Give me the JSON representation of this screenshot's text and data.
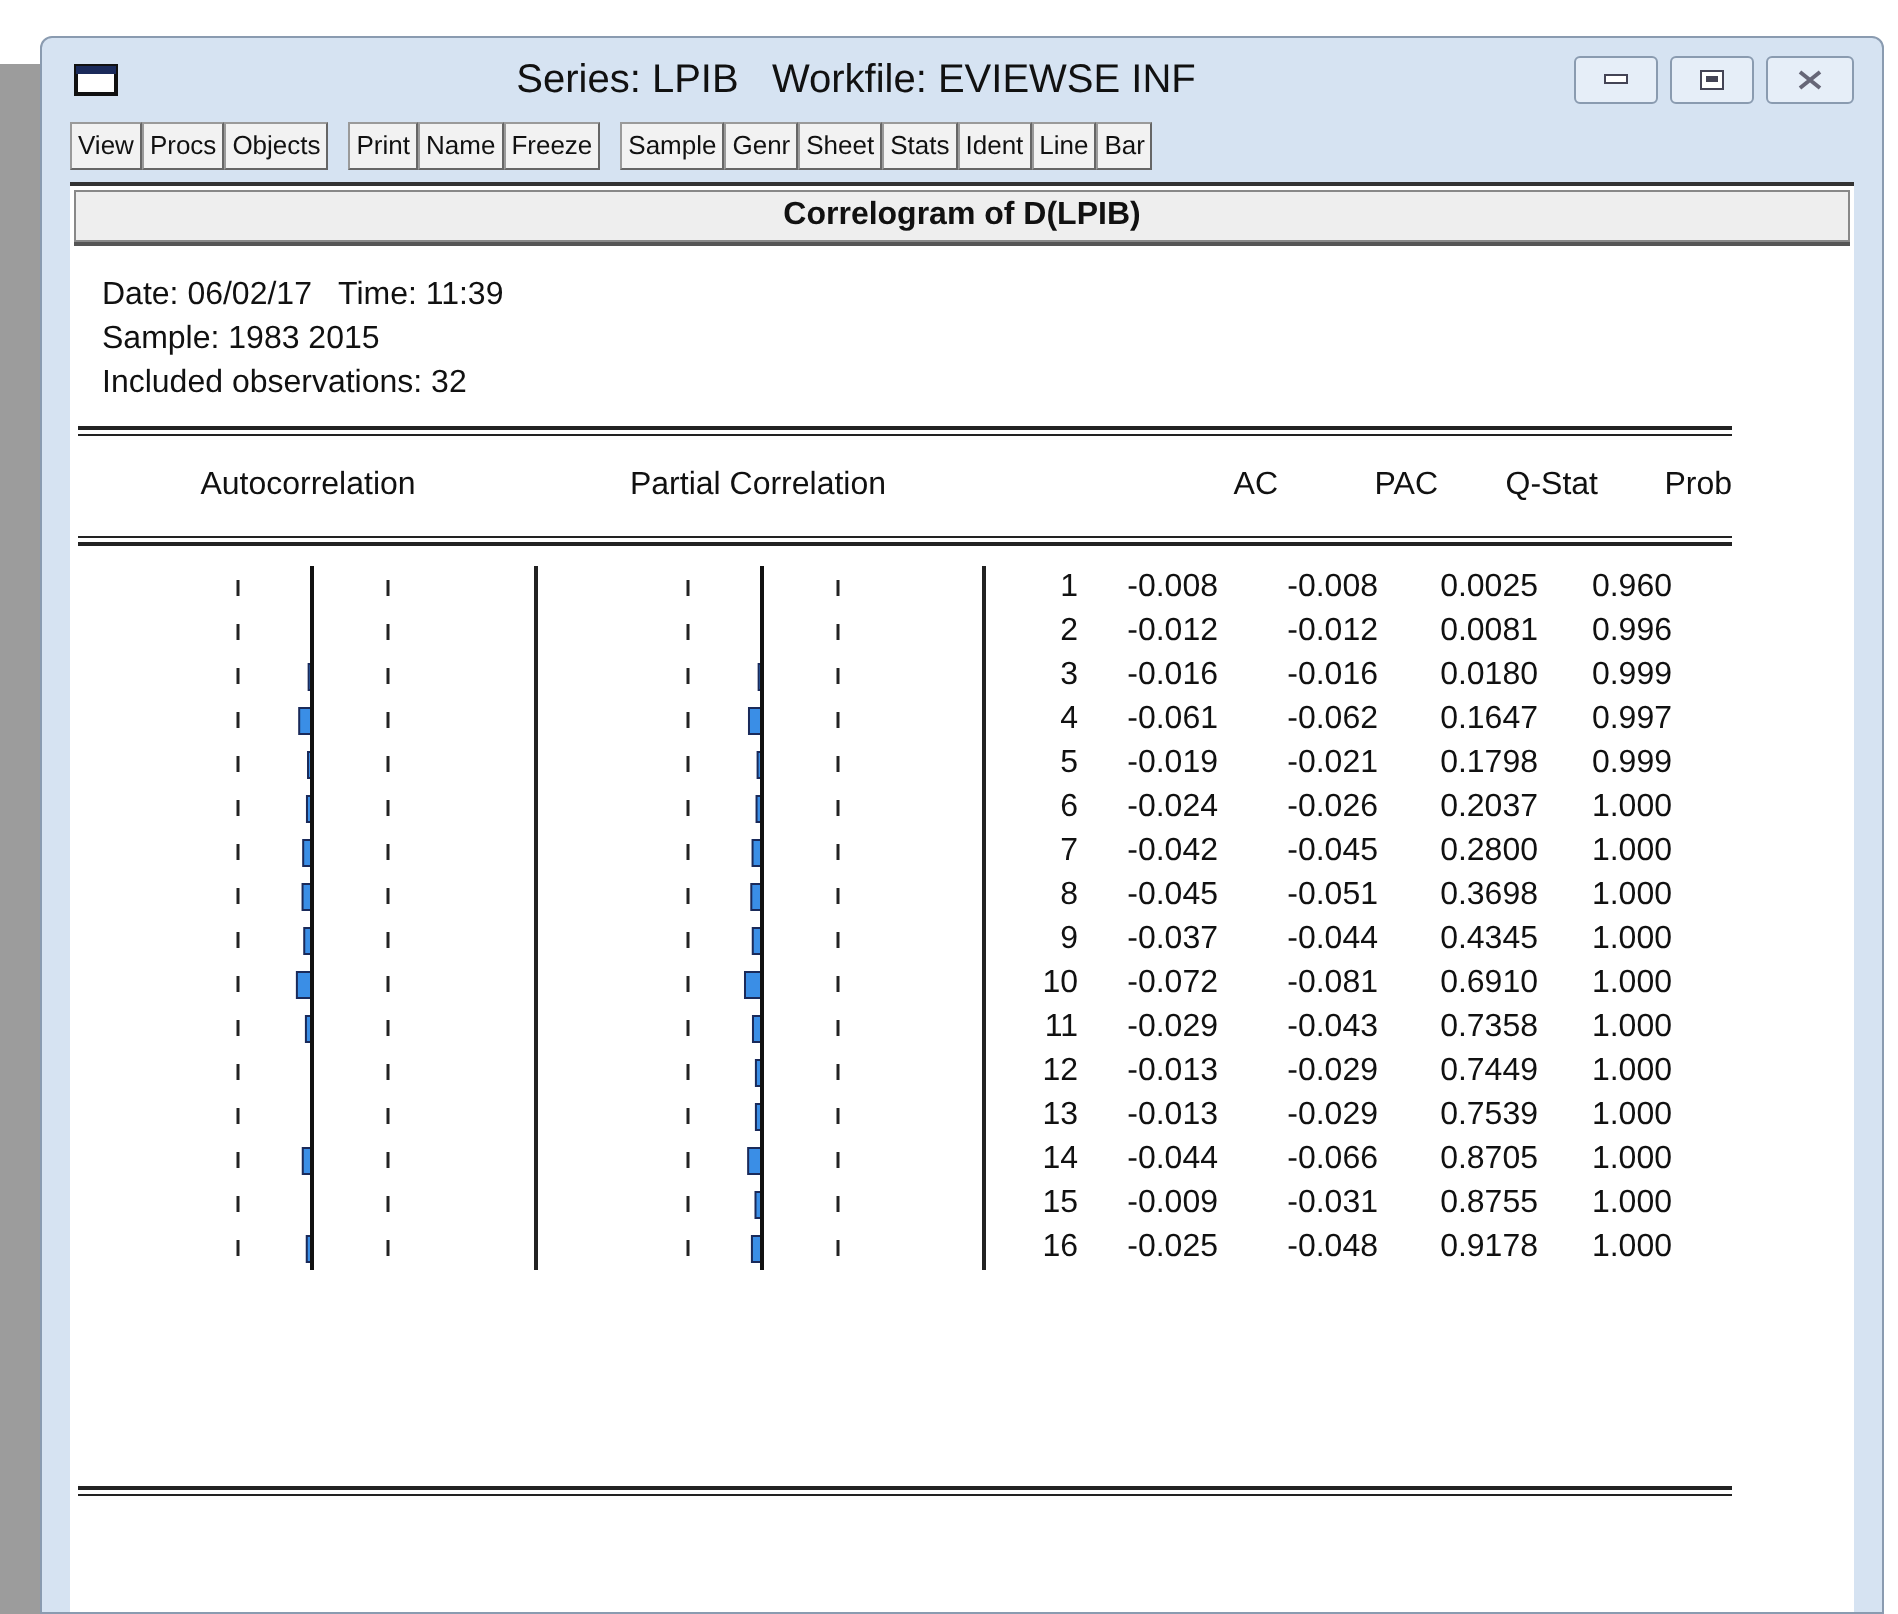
{
  "window": {
    "title": "Series: LPIB   Workfile: EVIEWSE INF"
  },
  "toolbar": [
    [
      "View",
      "Procs",
      "Objects"
    ],
    [
      "Print",
      "Name",
      "Freeze"
    ],
    [
      "Sample",
      "Genr",
      "Sheet",
      "Stats",
      "Ident",
      "Line",
      "Bar"
    ]
  ],
  "output": {
    "title": "Correlogram of D(LPIB)",
    "info": [
      "Date: 06/02/17   Time: 11:39",
      "Sample: 1983 2015",
      "Included observations: 32"
    ],
    "columns": [
      "Autocorrelation",
      "Partial Correlation",
      "AC",
      "PAC",
      "Q-Stat",
      "Prob"
    ],
    "rows": [
      [
        "1",
        "-0.008",
        "-0.008",
        "0.0025",
        "0.960"
      ],
      [
        "2",
        "-0.012",
        "-0.012",
        "0.0081",
        "0.996"
      ],
      [
        "3",
        "-0.016",
        "-0.016",
        "0.0180",
        "0.999"
      ],
      [
        "4",
        "-0.061",
        "-0.062",
        "0.1647",
        "0.997"
      ],
      [
        "5",
        "-0.019",
        "-0.021",
        "0.1798",
        "0.999"
      ],
      [
        "6",
        "-0.024",
        "-0.026",
        "0.2037",
        "1.000"
      ],
      [
        "7",
        "-0.042",
        "-0.045",
        "0.2800",
        "1.000"
      ],
      [
        "8",
        "-0.045",
        "-0.051",
        "0.3698",
        "1.000"
      ],
      [
        "9",
        "-0.037",
        "-0.044",
        "0.4345",
        "1.000"
      ],
      [
        "10",
        "-0.072",
        "-0.081",
        "0.6910",
        "1.000"
      ],
      [
        "11",
        "-0.029",
        "-0.043",
        "0.7358",
        "1.000"
      ],
      [
        "12",
        "-0.013",
        "-0.029",
        "0.7449",
        "1.000"
      ],
      [
        "13",
        "-0.013",
        "-0.029",
        "0.7539",
        "1.000"
      ],
      [
        "14",
        "-0.044",
        "-0.066",
        "0.8705",
        "1.000"
      ],
      [
        "15",
        "-0.009",
        "-0.031",
        "0.8755",
        "1.000"
      ],
      [
        "16",
        "-0.025",
        "-0.048",
        "0.9178",
        "1.000"
      ]
    ]
  }
}
